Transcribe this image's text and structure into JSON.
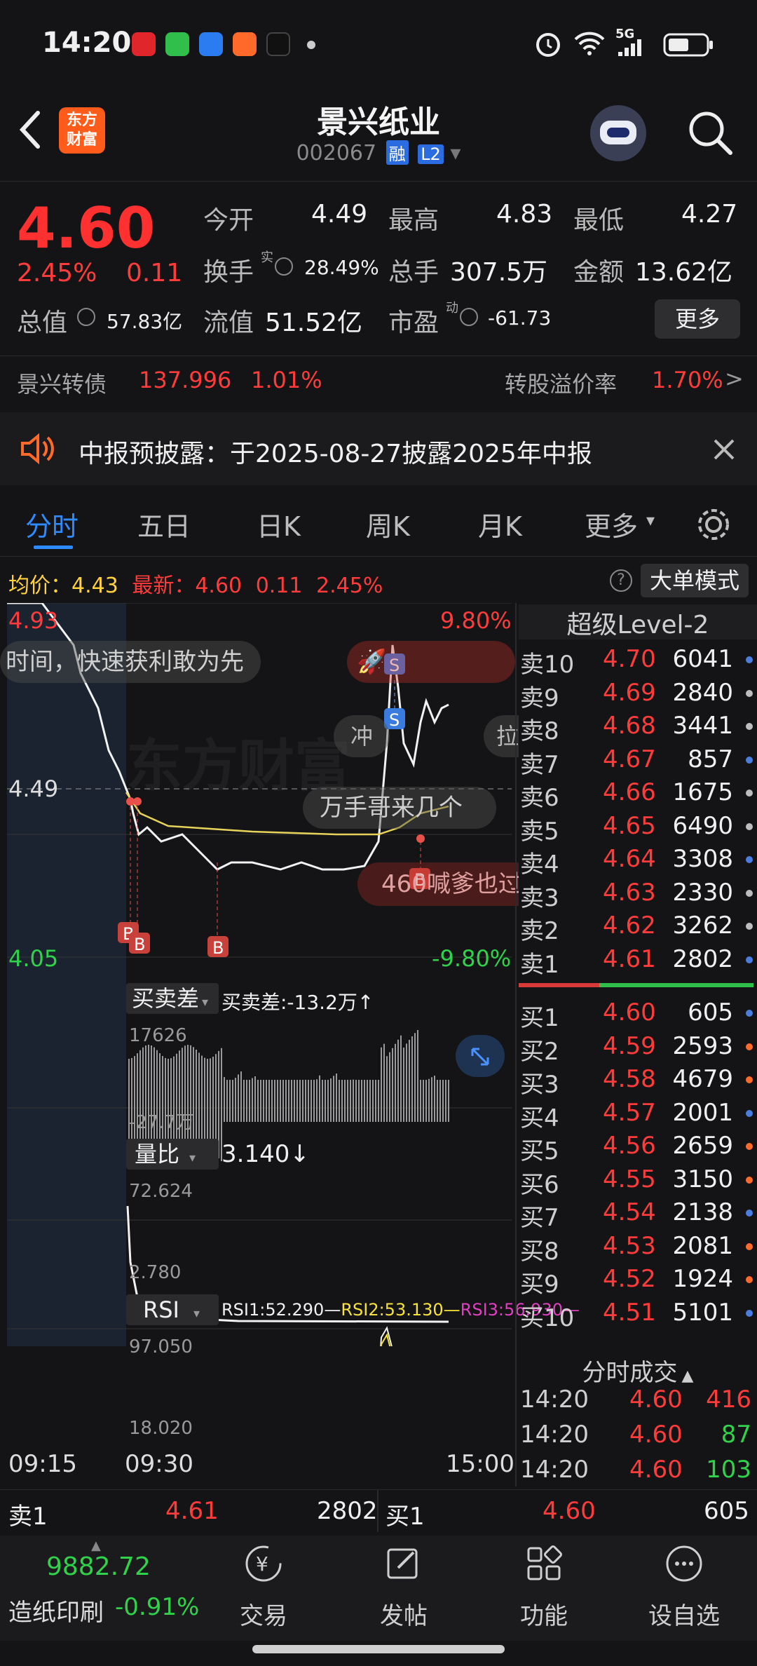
{
  "status": {
    "time": "14:20",
    "signal": "5G"
  },
  "header": {
    "back": "back",
    "logo_line1": "东方",
    "logo_line2": "财富",
    "title": "景兴纸业",
    "code": "002067",
    "tag_rong": "融",
    "tag_l2": "L2"
  },
  "quote": {
    "price": "4.60",
    "pct": "2.45%",
    "change": "0.11",
    "open_label": "今开",
    "open": "4.49",
    "high_label": "最高",
    "high": "4.83",
    "low_label": "最低",
    "low": "4.27",
    "turnover_label": "换手",
    "turnover_sup": "实",
    "turnover": "28.49%",
    "volume_label": "总手",
    "volume": "307.5万",
    "amount_label": "金额",
    "amount": "13.62亿",
    "mcap_label": "总值",
    "mcap": "57.83亿",
    "float_label": "流值",
    "float": "51.52亿",
    "pe_label": "市盈",
    "pe_sup": "动",
    "pe": "-61.73",
    "more": "更多",
    "bond_label": "景兴转债",
    "bond_price": "137.996",
    "bond_pct": "1.01%",
    "premium_label": "转股溢价率",
    "premium": "1.70%"
  },
  "notice": {
    "text": "中报预披露：于2025-08-27披露2025年中报"
  },
  "tabs": [
    "分时",
    "五日",
    "日K",
    "周K",
    "月K",
    "更多"
  ],
  "chart": {
    "avg_label": "均价：",
    "avg": "4.43",
    "latest_label": "最新：",
    "latest": "4.60",
    "latest_chg": "0.11",
    "latest_pct": "2.45%",
    "bigorder": "大单模式",
    "y_top": "4.93",
    "y_mid": "4.49",
    "y_bot": "4.05",
    "pct_top": "9.80%",
    "pct_bot": "-9.80%",
    "danmu1": "时间，快速获利敢为先",
    "danmu2": "万手哥来几个",
    "danmu3": "460喊爹也过",
    "danmu4": "冲",
    "danmu5": "拉",
    "wm": "东方财富",
    "ind1_name": "买卖差",
    "ind1_val": "买卖差:-13.2万↑",
    "ind1_top": "17626",
    "ind1_bot": "-27.7万",
    "ind2_name": "量比",
    "ind2_val": "3.140↓",
    "ind2_top": "72.624",
    "ind2_bot": "2.780",
    "ind3_name": "RSI",
    "rsi1": "RSI1:52.290—",
    "rsi2": "RSI2:53.130—",
    "rsi3": "RSI3:56.930—",
    "ind3_top": "97.050",
    "ind3_bot": "18.020",
    "t_start": "09:15",
    "t_open": "09:30",
    "t_end": "15:00",
    "colors": {
      "price_line": "#f2f2f2",
      "avg_line": "#e8d35a",
      "up": "#ff3b3b",
      "down": "#2fd24a"
    }
  },
  "level2": {
    "title": "超级Level-2",
    "asks": [
      {
        "k": "卖10",
        "p": "4.70",
        "v": "6041"
      },
      {
        "k": "卖9",
        "p": "4.69",
        "v": "2840"
      },
      {
        "k": "卖8",
        "p": "4.68",
        "v": "3441"
      },
      {
        "k": "卖7",
        "p": "4.67",
        "v": "857"
      },
      {
        "k": "卖6",
        "p": "4.66",
        "v": "1675"
      },
      {
        "k": "卖5",
        "p": "4.65",
        "v": "6490"
      },
      {
        "k": "卖4",
        "p": "4.64",
        "v": "3308"
      },
      {
        "k": "卖3",
        "p": "4.63",
        "v": "2330"
      },
      {
        "k": "卖2",
        "p": "4.62",
        "v": "3262"
      },
      {
        "k": "卖1",
        "p": "4.61",
        "v": "2802"
      }
    ],
    "bids": [
      {
        "k": "买1",
        "p": "4.60",
        "v": "605"
      },
      {
        "k": "买2",
        "p": "4.59",
        "v": "2593"
      },
      {
        "k": "买3",
        "p": "4.58",
        "v": "4679"
      },
      {
        "k": "买4",
        "p": "4.57",
        "v": "2001"
      },
      {
        "k": "买5",
        "p": "4.56",
        "v": "2659"
      },
      {
        "k": "买6",
        "p": "4.55",
        "v": "3150"
      },
      {
        "k": "买7",
        "p": "4.54",
        "v": "2138"
      },
      {
        "k": "买8",
        "p": "4.53",
        "v": "2081"
      },
      {
        "k": "买9",
        "p": "4.52",
        "v": "1924"
      },
      {
        "k": "买10",
        "p": "4.51",
        "v": "5101"
      }
    ],
    "ticks_title": "分时成交",
    "ticks": [
      {
        "t": "14:20",
        "p": "4.60",
        "v": "416"
      },
      {
        "t": "14:20",
        "p": "4.60",
        "v": "87"
      },
      {
        "t": "14:20",
        "p": "4.60",
        "v": "103"
      }
    ]
  },
  "bottom_quote": {
    "ask_label": "卖1",
    "ask_price": "4.61",
    "ask_vol": "2802",
    "bid_label": "买1",
    "bid_price": "4.60",
    "bid_vol": "605"
  },
  "navbar": {
    "index_value": "9882.72",
    "index_name": "造纸印刷",
    "index_pct": "-0.91%",
    "items": [
      "交易",
      "发帖",
      "功能",
      "设自选"
    ]
  }
}
